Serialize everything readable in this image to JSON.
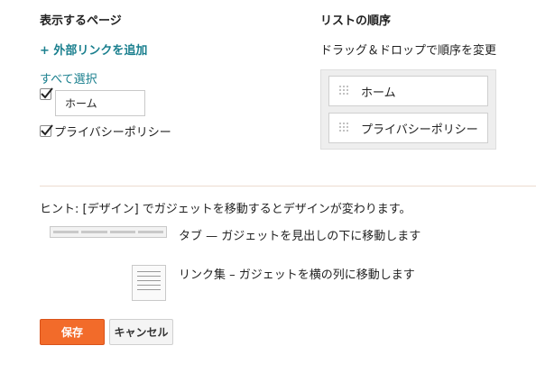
{
  "pages_section": {
    "heading": "表示するページ",
    "add_link": "+ 外部リンクを追加",
    "select_all": "すべて選択",
    "items": [
      {
        "label": "ホーム",
        "checked": true,
        "editable": true
      },
      {
        "label": "プライバシーポリシー",
        "checked": true,
        "editable": false
      }
    ]
  },
  "order_section": {
    "heading": "リストの順序",
    "subheading": "ドラッグ＆ドロップで順序を変更",
    "items": [
      "ホーム",
      "プライバシーポリシー"
    ]
  },
  "hint": {
    "text": "ヒント: [デザイン] でガジェットを移動するとデザインが変わります。",
    "tab_option": "タブ — ガジェットを見出しの下に移動します",
    "list_option": "リンク集 – ガジェットを横の列に移動します"
  },
  "buttons": {
    "save": "保存",
    "cancel": "キャンセル"
  },
  "colors": {
    "link": "#1a7f8e",
    "save_button": "#f26b2a"
  }
}
